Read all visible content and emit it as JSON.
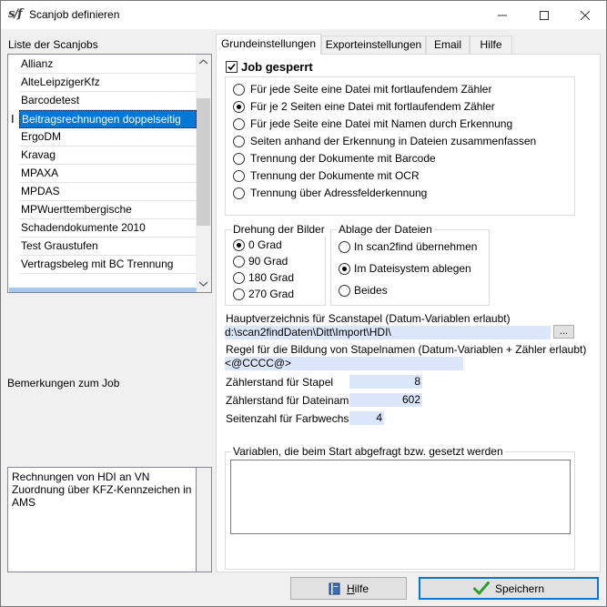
{
  "window": {
    "app_icon_text": "s/f",
    "title": "Scanjob definieren",
    "minimize_glyph": "—",
    "maximize_glyph": "☐",
    "close_glyph": "✕"
  },
  "left": {
    "list_label": "Liste der Scanjobs",
    "jobs": [
      "Allianz",
      "AlteLeipzigerKfz",
      "Barcodetest",
      "Beitragsrechnungen doppelseitig",
      "ErgoDM",
      "Kravag",
      "MPAXA",
      "MPDAS",
      "MPWuerttembergische",
      "Schadendokumente 2010",
      "Test Graustufen",
      "Vertragsbeleg mit BC Trennung"
    ],
    "selected_index": 3,
    "remarks_label": "Bemerkungen zum Job",
    "remarks_text": "Rechnungen von HDI an VN\nZuordnung über KFZ-Kennzeichen in AMS"
  },
  "tabs": [
    "Grundeinstellungen",
    "Exporteinstellungen",
    "Email",
    "Hilfe"
  ],
  "active_tab": 0,
  "basic": {
    "job_locked_label": "Job gesperrt",
    "job_locked_checked": true,
    "modes": [
      "Für jede Seite eine Datei mit fortlaufendem Zähler",
      "Für je 2 Seiten eine Datei mit fortlaufendem Zähler",
      "Für jede Seite eine Datei mit Namen durch Erkennung",
      "Seiten anhand der Erkennung in Dateien zusammenfassen",
      "Trennung der Dokumente mit Barcode",
      "Trennung der Dokumente mit OCR",
      "Trennung über Adressfelderkennung"
    ],
    "selected_mode": 1,
    "rotation_title": "Drehung der Bilder",
    "rotations": [
      "0 Grad",
      "90 Grad",
      "180 Grad",
      "270 Grad"
    ],
    "selected_rotation": 0,
    "storage_title": "Ablage der Dateien",
    "storage": [
      "In scan2find übernehmen",
      "Im Dateisystem ablegen",
      "Beides"
    ],
    "selected_storage": 1,
    "main_dir_label": "Hauptverzeichnis für Scanstapel (Datum-Variablen erlaubt)",
    "main_dir_value": "d:\\scan2findDaten\\Ditt\\Import\\HDI\\",
    "browse_label": "...",
    "batch_rule_label": "Regel für die Bildung von Stapelnamen (Datum-Variablen + Zähler erlaubt)",
    "batch_rule_value": "<@CCCC@>",
    "counter_batch_label": "Zählerstand für Stapel",
    "counter_batch_value": "8",
    "counter_file_label": "Zählerstand für Dateiname",
    "counter_file_value": "602",
    "pages_color_label": "Seitenzahl für Farbwechsel",
    "pages_color_value": "4",
    "variables_title": "Variablen, die beim Start abgefragt bzw. gesetzt werden"
  },
  "footer": {
    "help_label": "Hilfe",
    "help_underline": "H",
    "help_rest": "ilfe",
    "save_label": "Speichern"
  },
  "colors": {
    "selection": "#0078d7",
    "field_bg": "#dce6fa",
    "check_green": "#2e9e2e"
  }
}
